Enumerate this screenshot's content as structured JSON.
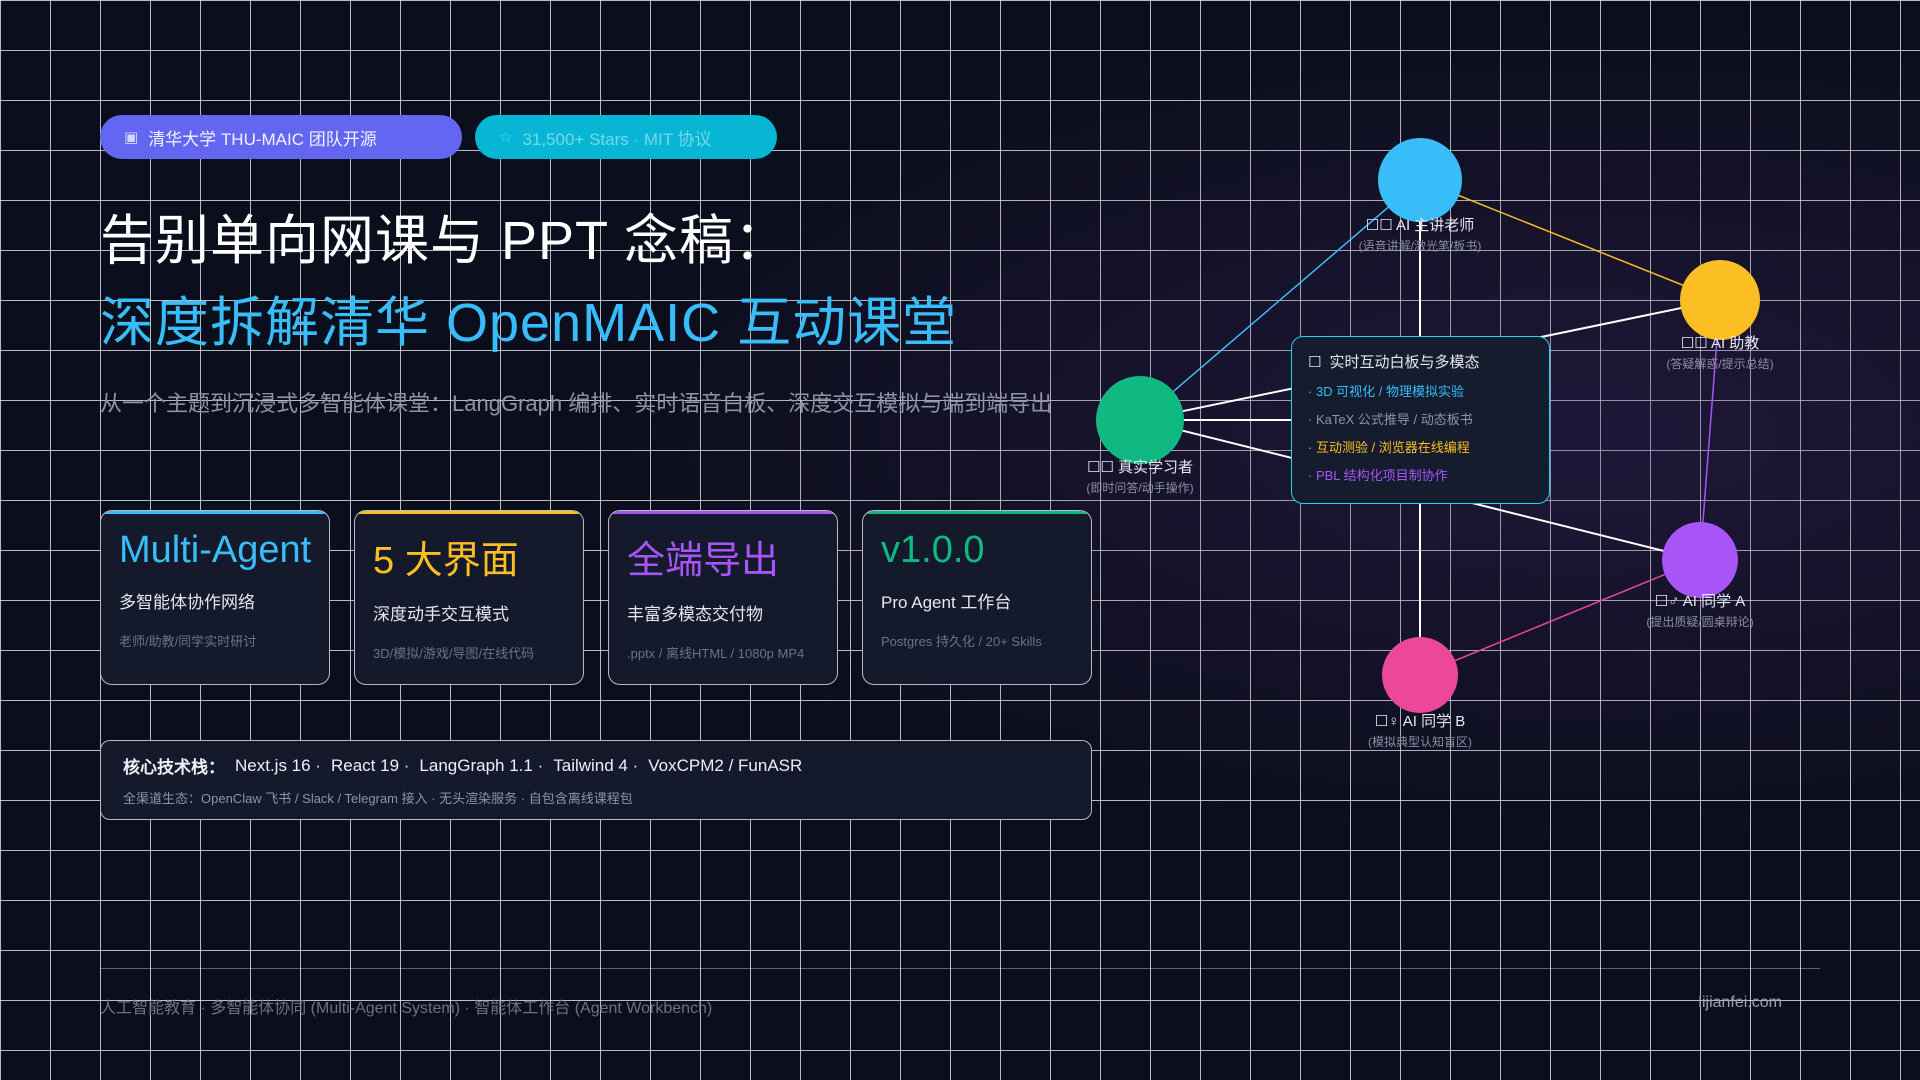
{
  "badges": [
    {
      "icon": "university-icon",
      "label": "清华大学 THU-MAIC 团队开源"
    },
    {
      "icon": "star-icon",
      "label": "31,500+ Stars · MIT 协议"
    }
  ],
  "hero": {
    "title_line1": "告别单向网课与 PPT 念稿：",
    "title_line2": "深度拆解清华 OpenMAIC 互动课堂",
    "subtitle": "从一个主题到沉浸式多智能体课堂：LangGraph 编排、实时语音白板、深度交互模拟与端到端导出"
  },
  "cards": [
    {
      "title": "Multi-Agent",
      "subtitle": "多智能体协作网络",
      "desc": "老师/助教/同学实时研讨",
      "color": "#38bdf8"
    },
    {
      "title": "5 大界面",
      "subtitle": "深度动手交互模式",
      "desc": "3D/模拟/游戏/导图/在线代码",
      "color": "#fbbf24"
    },
    {
      "title": "全端导出",
      "subtitle": "丰富多模态交付物",
      "desc": ".pptx / 离线HTML / 1080p MP4",
      "color": "#a855f7"
    },
    {
      "title": "v1.0.0",
      "subtitle": "Pro Agent 工作台",
      "desc": "Postgres 持久化 / 20+ Skills",
      "color": "#10b981"
    }
  ],
  "tech_stack": {
    "label": "核心技术栈：",
    "items": [
      "Next.js 16 ·",
      "React 19 ·",
      "LangGraph 1.1 ·",
      "Tailwind 4 ·",
      "VoxCPM2 / FunASR"
    ],
    "ecosystem": "全渠道生态：OpenClaw 飞书 / Slack / Telegram 接入 · 无头渲染服务 · 自包含离线课程包"
  },
  "network": {
    "nodes": [
      {
        "id": "teacher",
        "icon": "teacher-icon",
        "name": "AI 主讲老师",
        "role": "(语音讲解/激光笔/板书)",
        "color": "#38bdf8"
      },
      {
        "id": "assistant",
        "icon": "assistant-icon",
        "name": "AI 助教",
        "role": "(答疑解惑/提示总结)",
        "color": "#fbbf24"
      },
      {
        "id": "learner",
        "icon": "learner-icon",
        "name": "真实学习者",
        "role": "(即时问答/动手操作)",
        "color": "#10b981"
      },
      {
        "id": "peer_a",
        "icon": "male-peer-icon",
        "name": "AI 同学 A",
        "role": "(提出质疑/圆桌辩论)",
        "color": "#a855f7"
      },
      {
        "id": "peer_b",
        "icon": "female-peer-icon",
        "name": "AI 同学 B",
        "role": "(模拟典型认知盲区)",
        "color": "#ec4899"
      }
    ],
    "center": {
      "title": "实时互动白板与多模态",
      "items": [
        {
          "text": "· 3D 可视化 / 物理模拟实验",
          "color": "#38bdf8"
        },
        {
          "text": "· KaTeX 公式推导 / 动态板书",
          "color": "#8e94a6"
        },
        {
          "text": "· 互动测验 / 浏览器在线编程",
          "color": "#fbbf24"
        },
        {
          "text": "· PBL 结构化项目制协作",
          "color": "#a855f7"
        }
      ]
    }
  },
  "footer": {
    "tags": "人工智能教育 · 多智能体协同 (Multi-Agent System) · 智能体工作台 (Agent Workbench)",
    "site": "lijianfei.com"
  }
}
